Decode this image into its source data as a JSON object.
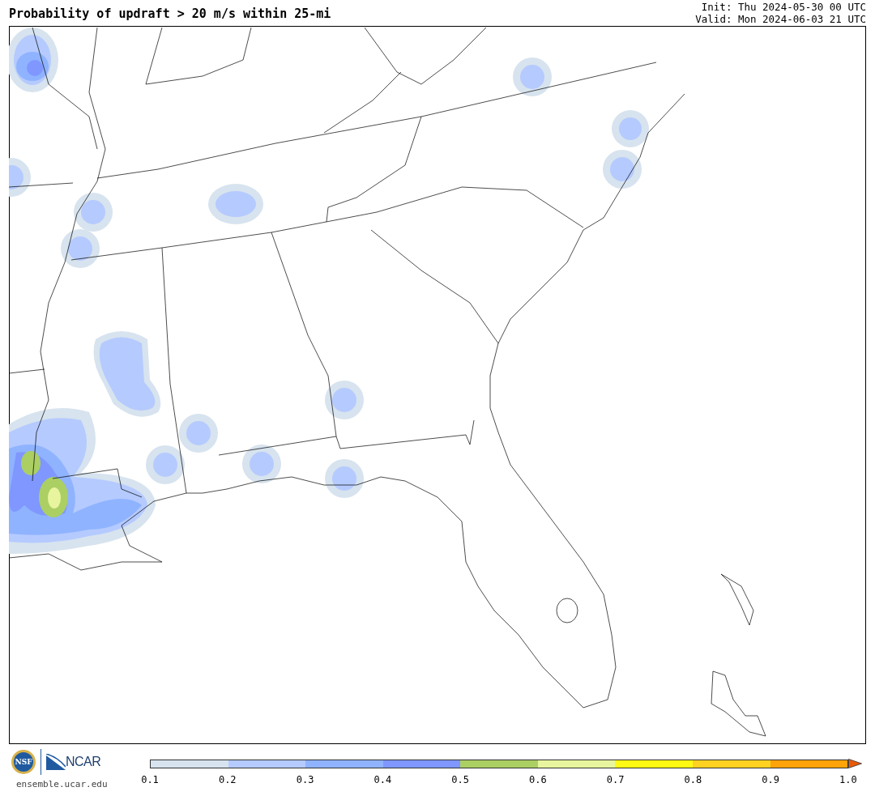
{
  "title": "Probability of updraft > 20 m/s within 25-mi",
  "init": "Init: Thu 2024-05-30 00 UTC",
  "valid": "Valid: Mon 2024-06-03 21 UTC",
  "logos": {
    "nsf": "NSF",
    "ncar": "NCAR"
  },
  "site": "ensemble.ucar.edu",
  "colorbar": {
    "bins": [
      {
        "color": "#d7e3ee"
      },
      {
        "color": "#b5caff"
      },
      {
        "color": "#8fb3ff"
      },
      {
        "color": "#7f97ff"
      },
      {
        "color": "#abcf63"
      },
      {
        "color": "#e8f59e"
      },
      {
        "color": "#fffa14"
      },
      {
        "color": "#ffd121"
      },
      {
        "color": "#ffa30a"
      },
      {
        "kind": "extend",
        "color": "#e85a0a"
      }
    ],
    "ticks": [
      "0.1",
      "0.2",
      "0.3",
      "0.4",
      "0.5",
      "0.6",
      "0.7",
      "0.8",
      "0.9",
      "1.0"
    ]
  }
}
